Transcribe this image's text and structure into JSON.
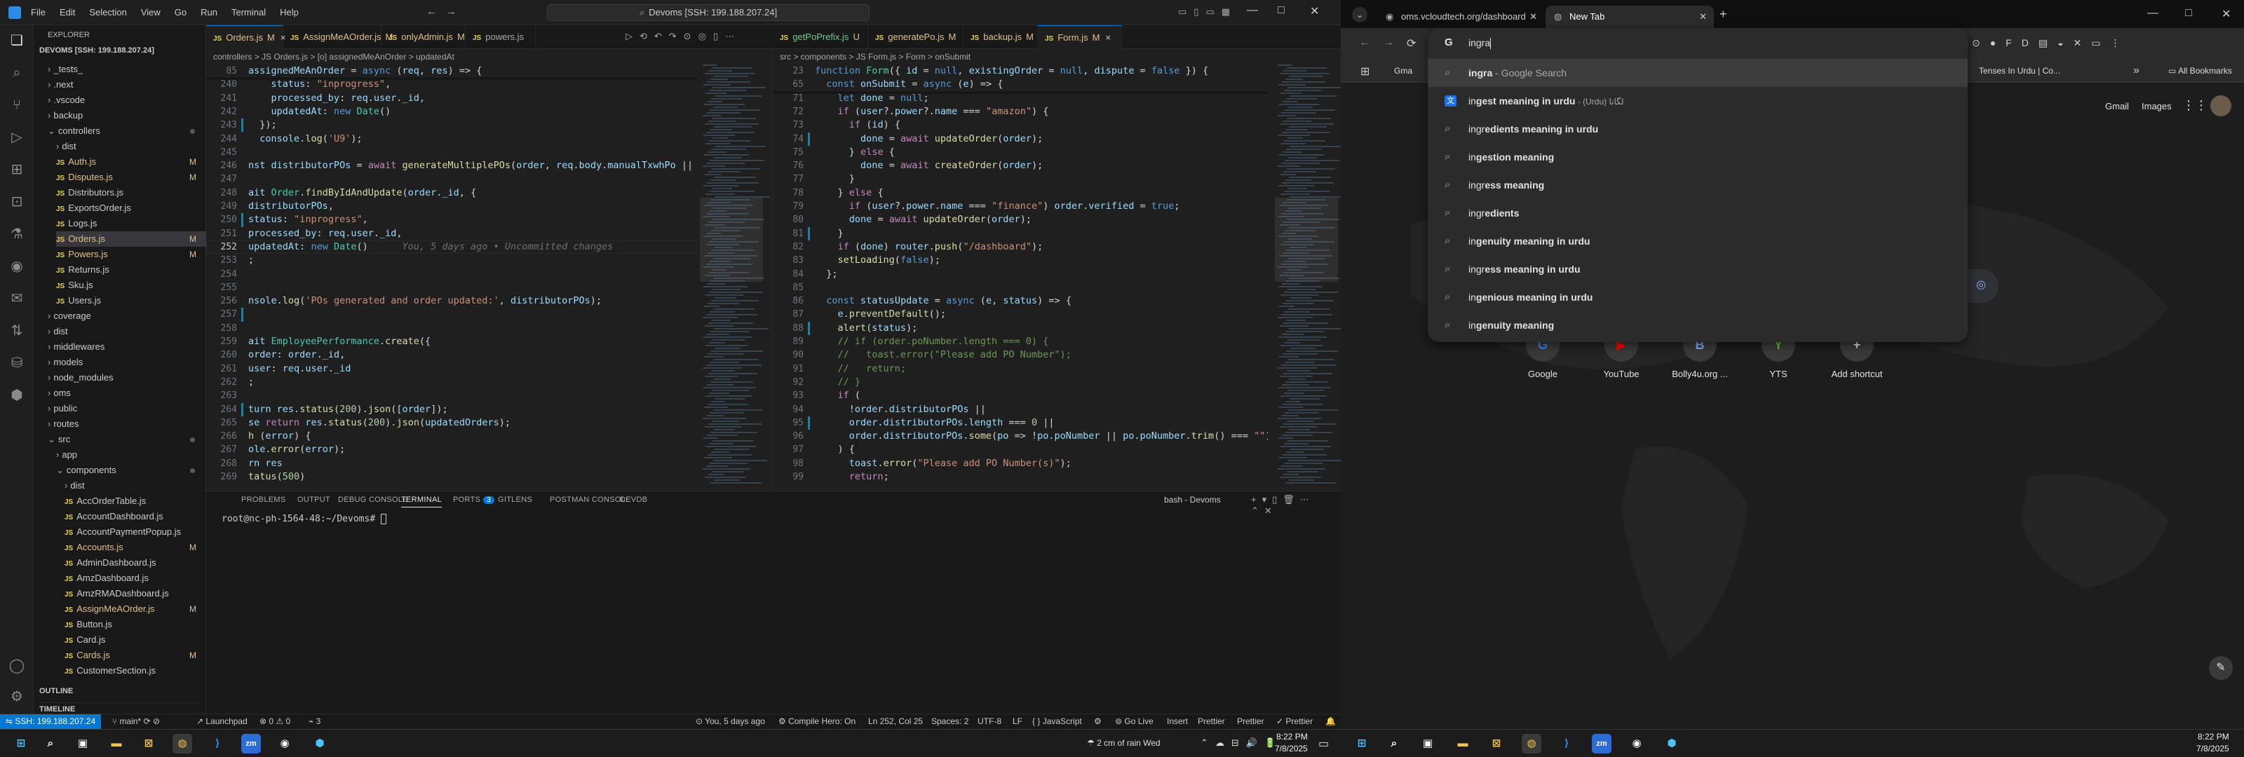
{
  "vscode": {
    "menu": [
      "File",
      "Edit",
      "Selection",
      "View",
      "Go",
      "Run",
      "Terminal",
      "Help"
    ],
    "command_center": "Devoms [SSH: 199.188.207.24]",
    "explorer_title": "EXPLORER",
    "root_folder": "DEVOMS [SSH: 199.188.207.24]",
    "tree": [
      {
        "label": "_tests_",
        "type": "folder",
        "depth": 1
      },
      {
        "label": ".next",
        "type": "folder",
        "depth": 1
      },
      {
        "label": ".vscode",
        "type": "folder",
        "depth": 1
      },
      {
        "label": "backup",
        "type": "folder",
        "depth": 1
      },
      {
        "label": "controllers",
        "type": "folder-open",
        "depth": 1
      },
      {
        "label": "dist",
        "type": "folder",
        "depth": 2
      },
      {
        "label": "Auth.js",
        "type": "js",
        "depth": 2,
        "badge": "M"
      },
      {
        "label": "Disputes.js",
        "type": "js",
        "depth": 2,
        "badge": "M"
      },
      {
        "label": "Distributors.js",
        "type": "js",
        "depth": 2
      },
      {
        "label": "ExportsOrder.js",
        "type": "js",
        "depth": 2
      },
      {
        "label": "Logs.js",
        "type": "js",
        "depth": 2
      },
      {
        "label": "Orders.js",
        "type": "js",
        "depth": 2,
        "badge": "M",
        "selected": true
      },
      {
        "label": "Powers.js",
        "type": "js",
        "depth": 2,
        "badge": "M"
      },
      {
        "label": "Returns.js",
        "type": "js",
        "depth": 2
      },
      {
        "label": "Sku.js",
        "type": "js",
        "depth": 2
      },
      {
        "label": "Users.js",
        "type": "js",
        "depth": 2
      },
      {
        "label": "coverage",
        "type": "folder",
        "depth": 1
      },
      {
        "label": "dist",
        "type": "folder",
        "depth": 1
      },
      {
        "label": "middlewares",
        "type": "folder",
        "depth": 1
      },
      {
        "label": "models",
        "type": "folder",
        "depth": 1
      },
      {
        "label": "node_modules",
        "type": "folder",
        "depth": 1
      },
      {
        "label": "oms",
        "type": "folder",
        "depth": 1
      },
      {
        "label": "public",
        "type": "folder",
        "depth": 1
      },
      {
        "label": "routes",
        "type": "folder",
        "depth": 1
      },
      {
        "label": "src",
        "type": "folder-open",
        "depth": 1
      },
      {
        "label": "app",
        "type": "folder",
        "depth": 2
      },
      {
        "label": "components",
        "type": "folder-open",
        "depth": 2
      },
      {
        "label": "dist",
        "type": "folder",
        "depth": 3
      },
      {
        "label": "AccOrderTable.js",
        "type": "js",
        "depth": 3
      },
      {
        "label": "AccountDashboard.js",
        "type": "js",
        "depth": 3
      },
      {
        "label": "AccountPaymentPopup.js",
        "type": "js",
        "depth": 3
      },
      {
        "label": "Accounts.js",
        "type": "js",
        "depth": 3,
        "badge": "M"
      },
      {
        "label": "AdminDashboard.js",
        "type": "js",
        "depth": 3
      },
      {
        "label": "AmzDashboard.js",
        "type": "js",
        "depth": 3
      },
      {
        "label": "AmzRMADashboard.js",
        "type": "js",
        "depth": 3
      },
      {
        "label": "AssignMeAOrder.js",
        "type": "js",
        "depth": 3,
        "badge": "M"
      },
      {
        "label": "Button.js",
        "type": "js",
        "depth": 3
      },
      {
        "label": "Card.js",
        "type": "js",
        "depth": 3
      },
      {
        "label": "Cards.js",
        "type": "js",
        "depth": 3,
        "badge": "M"
      },
      {
        "label": "CustomerSection.js",
        "type": "js",
        "depth": 3
      }
    ],
    "outline": "OUTLINE",
    "timeline": "TIMELINE",
    "tabs": [
      {
        "label": "Orders.js",
        "mod": "M",
        "active": true,
        "close": "×"
      },
      {
        "label": "AssignMeAOrder.js",
        "mod": "M"
      },
      {
        "label": "onlyAdmin.js",
        "mod": "M"
      },
      {
        "label": "powers.js",
        "mod": ""
      }
    ],
    "tabs_right": [
      {
        "label": "getPoPrefix.js",
        "mod": "U"
      },
      {
        "label": "generatePo.js",
        "mod": "M"
      },
      {
        "label": "backup.js",
        "mod": "M"
      },
      {
        "label": "Form.js",
        "mod": "M",
        "active": true,
        "close": "×"
      }
    ],
    "breadcrumb_left": "controllers > JS Orders.js > [o] assignedMeAnOrder > updatedAt",
    "breadcrumb_right": "src > components > JS Form.js > Form > onSubmit",
    "sticky_left": {
      "ln": "85",
      "code": "assignedMeAnOrder = async (req, res) => {"
    },
    "code_left": [
      {
        "ln": "240",
        "code": "    status: \"inprogress\","
      },
      {
        "ln": "241",
        "code": "    processed_by: req.user._id,"
      },
      {
        "ln": "242",
        "code": "    updatedAt: new Date()"
      },
      {
        "ln": "243",
        "code": "  });"
      },
      {
        "ln": "244",
        "code": "  console.log('U9');"
      },
      {
        "ln": "245",
        "code": ""
      },
      {
        "ln": "246",
        "code": "nst distributorPOs = await generateMultiplePOs(order, req.body.manualTxwhPo || nu"
      },
      {
        "ln": "247",
        "code": ""
      },
      {
        "ln": "248",
        "code": "ait Order.findByIdAndUpdate(order._id, {"
      },
      {
        "ln": "249",
        "code": "distributorPOs,"
      },
      {
        "ln": "250",
        "code": "status: \"inprogress\","
      },
      {
        "ln": "251",
        "code": "processed_by: req.user._id,"
      },
      {
        "ln": "252",
        "code": "updatedAt: new Date()",
        "ghost": "You, 5 days ago • Uncommitted changes"
      },
      {
        "ln": "253",
        "code": ";"
      },
      {
        "ln": "254",
        "code": ""
      },
      {
        "ln": "255",
        "code": ""
      },
      {
        "ln": "256",
        "code": "nsole.log('POs generated and order updated:', distributorPOs);"
      },
      {
        "ln": "257",
        "code": ""
      },
      {
        "ln": "258",
        "code": ""
      },
      {
        "ln": "259",
        "code": "ait EmployeePerformance.create({"
      },
      {
        "ln": "260",
        "code": "order: order._id,"
      },
      {
        "ln": "261",
        "code": "user: req.user._id"
      },
      {
        "ln": "262",
        "code": ";"
      },
      {
        "ln": "263",
        "code": ""
      },
      {
        "ln": "264",
        "code": "turn res.status(200).json([order]);"
      },
      {
        "ln": "265",
        "code": "se return res.status(200).json(updatedOrders);"
      },
      {
        "ln": "266",
        "code": "h (error) {"
      },
      {
        "ln": "267",
        "code": "ole.error(error);"
      },
      {
        "ln": "268",
        "code": "rn res"
      },
      {
        "ln": "269",
        "code": "tatus(500)"
      }
    ],
    "sticky_right": [
      {
        "ln": "23",
        "code": "function Form({ id = null, existingOrder = null, dispute = false }) {"
      },
      {
        "ln": "65",
        "code": "  const onSubmit = async (e) => {"
      }
    ],
    "code_right": [
      {
        "ln": "71",
        "code": "    let done = null;"
      },
      {
        "ln": "72",
        "code": "    if (user?.power?.name === \"amazon\") {"
      },
      {
        "ln": "73",
        "code": "      if (id) {"
      },
      {
        "ln": "74",
        "code": "        done = await updateOrder(order);"
      },
      {
        "ln": "75",
        "code": "      } else {"
      },
      {
        "ln": "76",
        "code": "        done = await createOrder(order);"
      },
      {
        "ln": "77",
        "code": "      }"
      },
      {
        "ln": "78",
        "code": "    } else {"
      },
      {
        "ln": "79",
        "code": "      if (user?.power.name === \"finance\") order.verified = true;"
      },
      {
        "ln": "80",
        "code": "      done = await updateOrder(order);"
      },
      {
        "ln": "81",
        "code": "    }"
      },
      {
        "ln": "82",
        "code": "    if (done) router.push(\"/dashboard\");"
      },
      {
        "ln": "83",
        "code": "    setLoading(false);"
      },
      {
        "ln": "84",
        "code": "  };"
      },
      {
        "ln": "85",
        "code": ""
      },
      {
        "ln": "86",
        "code": "  const statusUpdate = async (e, status) => {"
      },
      {
        "ln": "87",
        "code": "    e.preventDefault();"
      },
      {
        "ln": "88",
        "code": "    alert(status);"
      },
      {
        "ln": "89",
        "code": "    // if (order.poNumber.length === 0) {"
      },
      {
        "ln": "90",
        "code": "    //   toast.error(\"Please add PO Number\");"
      },
      {
        "ln": "91",
        "code": "    //   return;"
      },
      {
        "ln": "92",
        "code": "    // }"
      },
      {
        "ln": "93",
        "code": "    if ("
      },
      {
        "ln": "94",
        "code": "      !order.distributorPOs ||"
      },
      {
        "ln": "95",
        "code": "      order.distributorPOs.length === 0 ||"
      },
      {
        "ln": "96",
        "code": "      order.distributorPOs.some(po => !po.poNumber || po.poNumber.trim() === \"\")"
      },
      {
        "ln": "97",
        "code": "    ) {"
      },
      {
        "ln": "98",
        "code": "      toast.error(\"Please add PO Number(s)\");"
      },
      {
        "ln": "99",
        "code": "      return;"
      }
    ],
    "panel_tabs": [
      "PROBLEMS",
      "OUTPUT",
      "DEBUG CONSOLE",
      "TERMINAL",
      "PORTS",
      "GITLENS",
      "POSTMAN CONSOLE",
      "DEVDB"
    ],
    "ports_badge": "3",
    "terminal_name": "bash - Devoms",
    "terminal_prompt": "root@nc-ph-1564-48:~/Devoms#",
    "status": {
      "remote": "SSH: 199.188.207.24",
      "branch": "main*",
      "launchpad": "Launchpad",
      "problems": "⊗ 0 ⚠ 0",
      "ports": "3",
      "blame": "You, 5 days ago",
      "compile": "Compile Hero: On",
      "position": "Ln 252, Col 25",
      "spaces": "Spaces: 2",
      "encoding": "UTF-8",
      "eol": "LF",
      "language": "JavaScript",
      "golive": "Go Live",
      "insert": "Insert",
      "prettier1": "Prettier",
      "prettier2": "Prettier",
      "prettier3": "Prettier"
    }
  },
  "chrome": {
    "tab1": "oms.vcloudtech.org/dashboard",
    "tab2": "New Tab",
    "omnibox_text": "ingra",
    "bookmarks_left": "Gma",
    "bookmark_tenses": "Tenses In Urdu | Co...",
    "all_bookmarks": "All Bookmarks",
    "gmail": "Gmail",
    "images": "Images",
    "suggestions": [
      {
        "typed": "ingra",
        "rest": " - Google Search",
        "icon": "search",
        "kind": "first"
      },
      {
        "typed": "in",
        "rest": "gest meaning in urdu",
        "extra": " - (Urdu) لگانا",
        "icon": "translate"
      },
      {
        "typed": "ingr",
        "rest": "edients meaning in urdu",
        "icon": "search"
      },
      {
        "typed": "in",
        "rest": "gestion meaning",
        "icon": "search"
      },
      {
        "typed": "ingr",
        "rest": "ess meaning",
        "icon": "search"
      },
      {
        "typed": "ingr",
        "rest": "edients",
        "icon": "search"
      },
      {
        "typed": "in",
        "rest": "genuity meaning in urdu",
        "icon": "search"
      },
      {
        "typed": "ingr",
        "rest": "ess meaning in urdu",
        "icon": "search"
      },
      {
        "typed": "in",
        "rest": "genious meaning in urdu",
        "icon": "search"
      },
      {
        "typed": "in",
        "rest": "genuity meaning",
        "icon": "search"
      }
    ],
    "shortcuts": [
      {
        "label": "Google",
        "letter": "G",
        "color": "#4285f4"
      },
      {
        "label": "YouTube",
        "letter": "▶",
        "color": "#ff0000"
      },
      {
        "label": "Bolly4u.org ...",
        "letter": "B",
        "color": "#8ab4f8"
      },
      {
        "label": "YTS",
        "letter": "Y",
        "color": "#6ac045"
      },
      {
        "label": "Add shortcut",
        "letter": "+",
        "color": "#e3e3e3"
      }
    ]
  },
  "taskbar": {
    "weather": "2 cm of rain Wed",
    "time": "8:22 PM",
    "date": "7/8/2025",
    "time2": "8:22 PM",
    "date2": "7/8/2025"
  }
}
